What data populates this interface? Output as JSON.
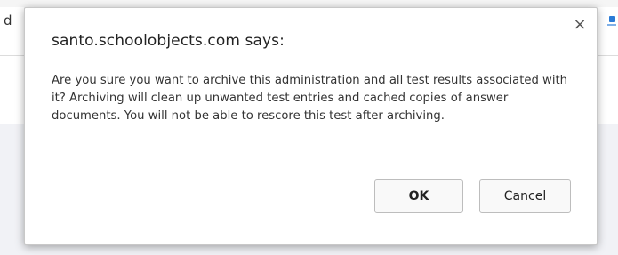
{
  "background": {
    "partial_text": "d"
  },
  "dialog": {
    "title": "santo.schoolobjects.com says:",
    "close_glyph": "×",
    "message": "Are you sure you want to archive this administration and all test results associated with it?  Archiving will clean up unwanted test entries and cached copies of answer documents.  You will not be able to rescore this test after archiving.",
    "ok_label": "OK",
    "cancel_label": "Cancel"
  },
  "colors": {
    "dialog_bg": "#ffffff",
    "page_lower_bg": "#f1f2f6",
    "button_border": "#bdbdbd"
  },
  "icons": {
    "close": "close-icon",
    "background_app": "app-icon"
  }
}
